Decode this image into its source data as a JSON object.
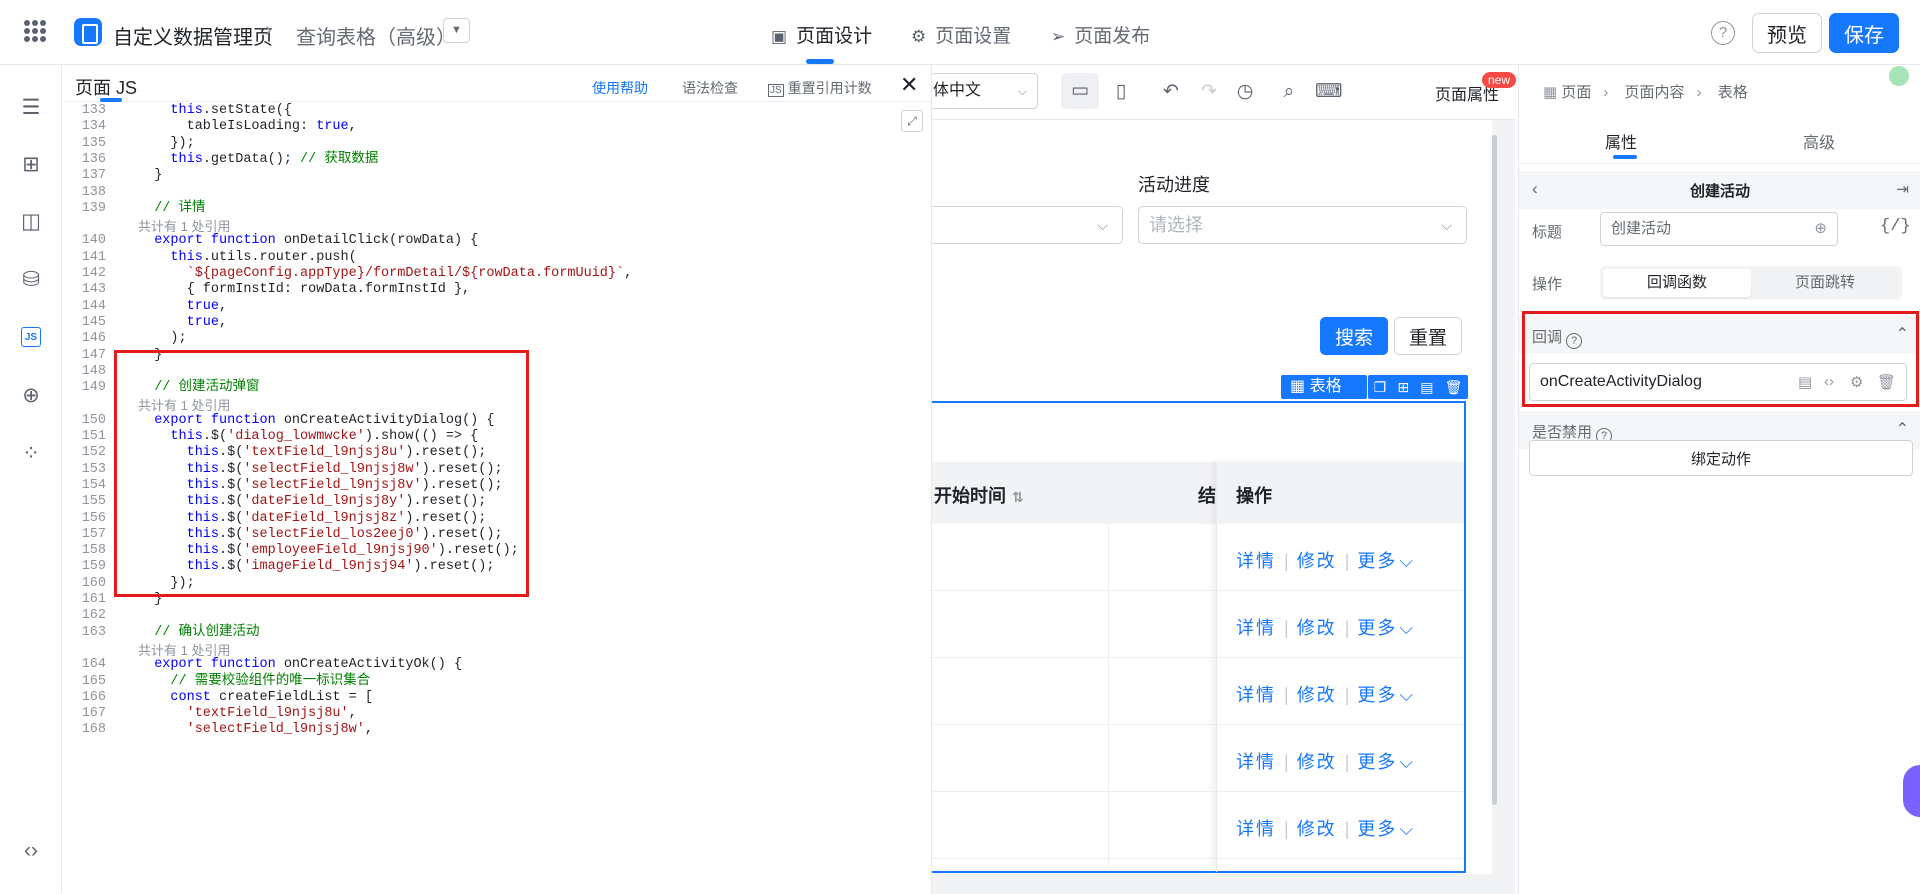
{
  "header": {
    "app_title": "自定义数据管理页",
    "page_name": "查询表格（高级）",
    "dropdown_glyph": "▼",
    "tabs": [
      "页面设计",
      "页面设置",
      "页面发布"
    ],
    "help_glyph": "?",
    "preview_label": "预览",
    "save_label": "保存"
  },
  "js_panel": {
    "title": "页面 JS",
    "help_link": "使用帮助",
    "syntax_check": "语法检查",
    "reset_ref_count": "重置引用计数",
    "js_badge": "JS"
  },
  "canvas_toolbar": {
    "language": "体中文",
    "page_attr": "页面属性",
    "new_badge": "new"
  },
  "form": {
    "activity_progress_label": "活动进度",
    "select_placeholder": "请选择",
    "search_label": "搜索",
    "reset_label": "重置"
  },
  "table": {
    "tag_label": "表格",
    "col_start_time": "开始时间",
    "col_end_partial": "结",
    "col_actions": "操作",
    "row_actions": {
      "detail": "详情",
      "edit": "修改",
      "more": "更多"
    },
    "row_count": 5
  },
  "right_panel": {
    "breadcrumb": [
      "页面",
      "页面内容",
      "表格"
    ],
    "tabs": [
      "属性",
      "高级"
    ],
    "component_title": "创建活动",
    "title_label": "标题",
    "title_value": "创建活动",
    "operation_label": "操作",
    "op_callback": "回调函数",
    "op_jump": "页面跳转",
    "callback_section": "回调",
    "callback_fn": "onCreateActivityDialog",
    "disable_section": "是否禁用",
    "bind_action": "绑定动作"
  },
  "colors": {
    "accent": "#1677ff",
    "highlight_box": "#e31b1b"
  },
  "code_lines": [
    {
      "n": "133",
      "t": "    this.setState({"
    },
    {
      "n": "134",
      "t": "      tableIsLoading: true,"
    },
    {
      "n": "135",
      "t": "    });"
    },
    {
      "n": "136",
      "t": "    this.getData(); // 获取数据"
    },
    {
      "n": "137",
      "t": "  }"
    },
    {
      "n": "138",
      "t": ""
    },
    {
      "n": "139",
      "t": "  // 详情"
    },
    {
      "ref": "共计有 1 处引用"
    },
    {
      "n": "140",
      "t": "  export function onDetailClick(rowData) {"
    },
    {
      "n": "141",
      "t": "    this.utils.router.push("
    },
    {
      "n": "142",
      "t": "      `${pageConfig.appType}/formDetail/${rowData.formUuid}`,"
    },
    {
      "n": "143",
      "t": "      { formInstId: rowData.formInstId },"
    },
    {
      "n": "144",
      "t": "      true,"
    },
    {
      "n": "145",
      "t": "      true,"
    },
    {
      "n": "146",
      "t": "    );"
    },
    {
      "n": "147",
      "t": "  }"
    },
    {
      "n": "148",
      "t": ""
    },
    {
      "n": "149",
      "t": "  // 创建活动弹窗"
    },
    {
      "ref": "共计有 1 处引用"
    },
    {
      "n": "150",
      "t": "  export function onCreateActivityDialog() {"
    },
    {
      "n": "151",
      "t": "    this.$('dialog_lowmwcke').show(() => {"
    },
    {
      "n": "152",
      "t": "      this.$('textField_l9njsj8u').reset();"
    },
    {
      "n": "153",
      "t": "      this.$('selectField_l9njsj8w').reset();"
    },
    {
      "n": "154",
      "t": "      this.$('selectField_l9njsj8v').reset();"
    },
    {
      "n": "155",
      "t": "      this.$('dateField_l9njsj8y').reset();"
    },
    {
      "n": "156",
      "t": "      this.$('dateField_l9njsj8z').reset();"
    },
    {
      "n": "157",
      "t": "      this.$('selectField_los2eej0').reset();"
    },
    {
      "n": "158",
      "t": "      this.$('employeeField_l9njsj90').reset();"
    },
    {
      "n": "159",
      "t": "      this.$('imageField_l9njsj94').reset();"
    },
    {
      "n": "160",
      "t": "    });"
    },
    {
      "n": "161",
      "t": "  }"
    },
    {
      "n": "162",
      "t": ""
    },
    {
      "n": "163",
      "t": "  // 确认创建活动"
    },
    {
      "ref": "共计有 1 处引用"
    },
    {
      "n": "164",
      "t": "  export function onCreateActivityOk() {"
    },
    {
      "n": "165",
      "t": "    // 需要校验组件的唯一标识集合"
    },
    {
      "n": "166",
      "t": "    const createFieldList = ["
    },
    {
      "n": "167",
      "t": "      'textField_l9njsj8u',"
    },
    {
      "n": "168",
      "t": "      'selectField_l9njsj8w',"
    }
  ]
}
